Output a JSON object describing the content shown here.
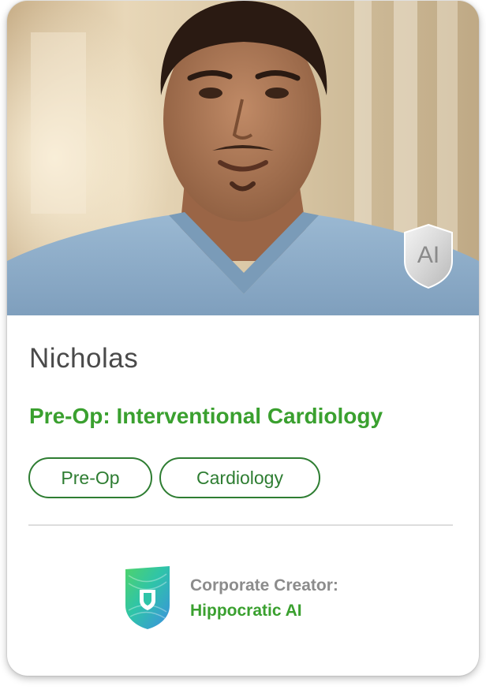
{
  "persona": {
    "name": "Nicholas",
    "role_title": "Pre-Op: Interventional Cardiology",
    "tags": [
      "Pre-Op",
      "Cardiology"
    ],
    "photo_badge": "AI"
  },
  "creator": {
    "label": "Corporate Creator:",
    "name": "Hippocratic AI",
    "logo_icon": "hippocratic-shield-logo"
  },
  "colors": {
    "accent_green": "#3aa02f",
    "tag_border": "#2e7d32",
    "name_text": "#4a4a4a",
    "muted_text": "#8c8c8c"
  }
}
